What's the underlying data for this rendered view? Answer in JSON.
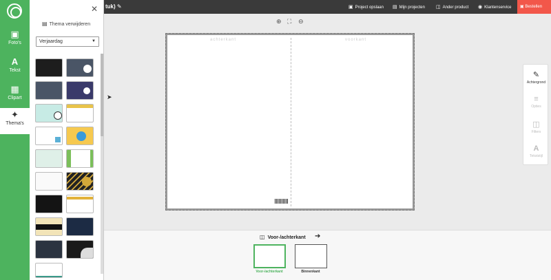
{
  "rail": {
    "items": [
      {
        "label": "Foto's",
        "icon": "photo-icon"
      },
      {
        "label": "Tekst",
        "icon": "text-icon"
      },
      {
        "label": "Clipart",
        "icon": "clipart-icon"
      },
      {
        "label": "Thema's",
        "icon": "magic-wand-icon"
      }
    ]
  },
  "panel": {
    "remove_label": "Thema verwijderen",
    "select_value": "Verjaardag"
  },
  "topbar": {
    "title": "tuk)",
    "save_label": "Project opslaan",
    "projects_label": "Mijn projecten",
    "other_label": "Ander product",
    "service_label": "Klantenservice",
    "order_label": "Bestellen"
  },
  "canvas": {
    "back_label": "achterkant",
    "front_label": "voorkant"
  },
  "tools": {
    "items": [
      {
        "label": "Achtergrond",
        "enabled": true
      },
      {
        "label": "Opties",
        "enabled": false
      },
      {
        "label": "Filters",
        "enabled": false
      },
      {
        "label": "Tekststijl",
        "enabled": false
      }
    ]
  },
  "bottom": {
    "nav_label": "Voor-/achterkant",
    "page1_label": "Voor-/achterkant",
    "page2_label": "Binnenkant"
  },
  "colors": {
    "brand_green": "#4db35e",
    "order_red": "#f2574a",
    "topbar": "#3a3a3a"
  }
}
